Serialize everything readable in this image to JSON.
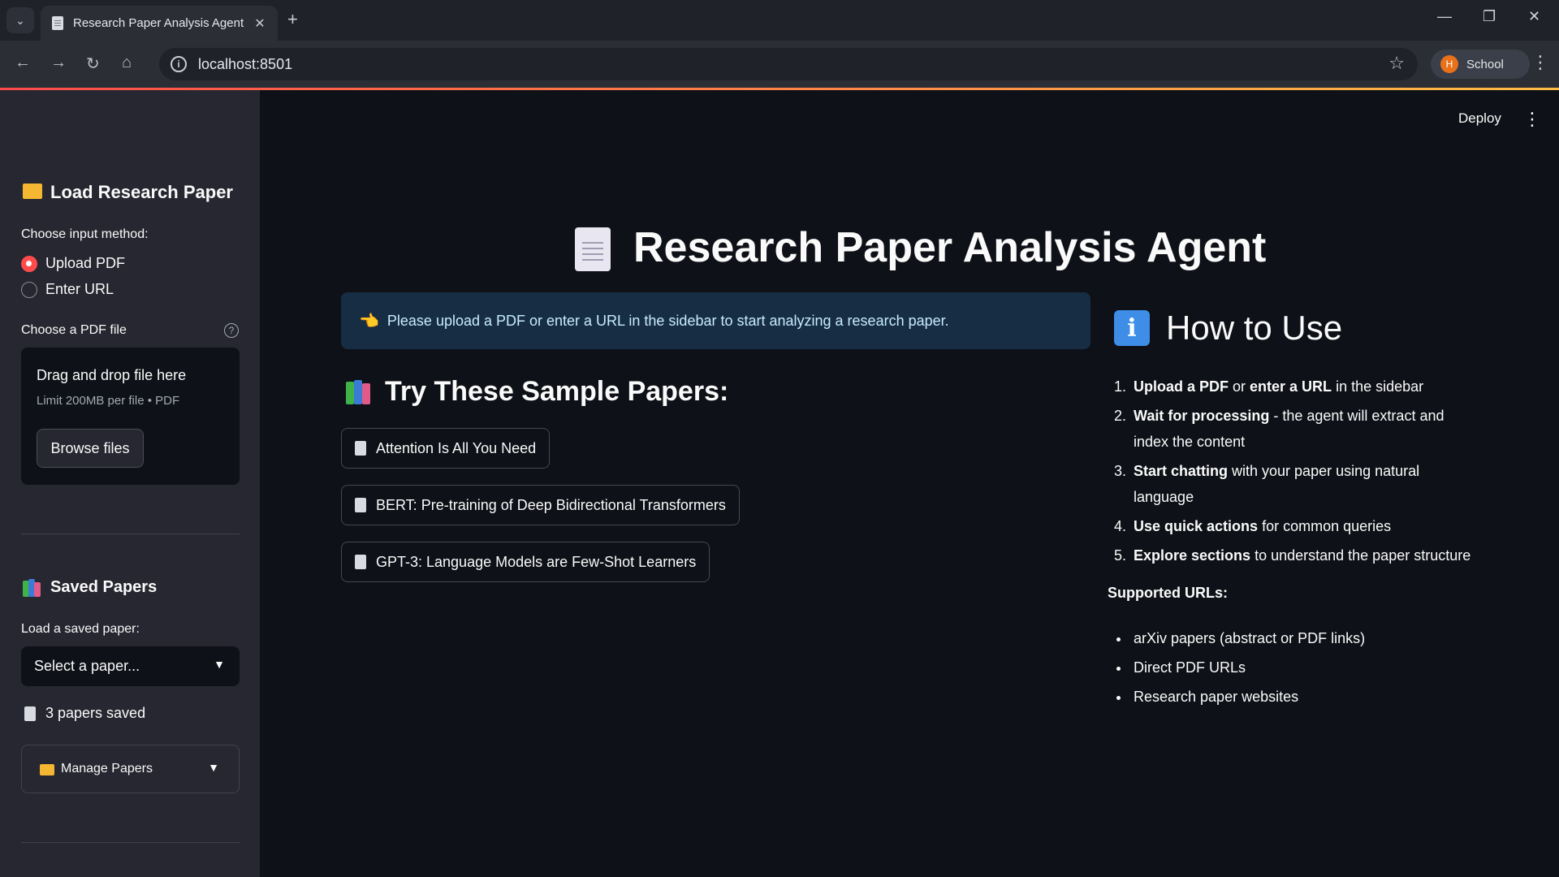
{
  "browser": {
    "tab_title": "Research Paper Analysis Agent",
    "url": "localhost:8501",
    "profile_initial": "H",
    "profile_name": "School"
  },
  "header": {
    "deploy_label": "Deploy"
  },
  "sidebar": {
    "load_heading": "Load Research Paper",
    "input_method_label": "Choose input method:",
    "options": [
      "Upload PDF",
      "Enter URL"
    ],
    "selected_option": "Upload PDF",
    "file_label": "Choose a PDF file",
    "dropzone_title": "Drag and drop file here",
    "dropzone_limit": "Limit 200MB per file • PDF",
    "browse_label": "Browse files",
    "saved_heading": "Saved Papers",
    "saved_select_label": "Load a saved paper:",
    "saved_select_placeholder": "Select a paper...",
    "saved_count": "3 papers saved",
    "manage_label": "Manage Papers"
  },
  "main": {
    "title": "Research Paper Analysis Agent",
    "info_message": "Please upload a PDF or enter a URL in the sidebar to start analyzing a research paper.",
    "samples_heading": "Try These Sample Papers:",
    "samples": [
      "Attention Is All You Need",
      "BERT: Pre-training of Deep Bidirectional Transformers",
      "GPT-3: Language Models are Few-Shot Learners"
    ]
  },
  "howto": {
    "heading": "How to Use",
    "steps": [
      {
        "b1": "Upload a PDF",
        "t1": " or ",
        "b2": "enter a URL",
        "t2": " in the sidebar"
      },
      {
        "b1": "Wait for processing",
        "t1": " - the agent will extract and index the content"
      },
      {
        "b1": "Start chatting",
        "t1": " with your paper using natural language"
      },
      {
        "b1": "Use quick actions",
        "t1": " for common queries"
      },
      {
        "b1": "Explore sections",
        "t1": " to understand the paper structure"
      }
    ],
    "supported_heading": "Supported URLs:",
    "supported": [
      "arXiv papers (abstract or PDF links)",
      "Direct PDF URLs",
      "Research paper websites"
    ]
  },
  "colors": {
    "accent": "#ff4b4b",
    "info_bg": "#172d43",
    "sidebar_bg": "#262730",
    "main_bg": "#0e1117"
  }
}
